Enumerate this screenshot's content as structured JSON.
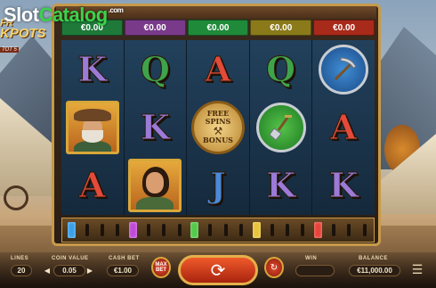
{
  "watermark": {
    "part1": "Slot",
    "part2": "Catalog",
    "part3": ".com"
  },
  "logo": {
    "line1": "FR",
    "line2": "KPOTS",
    "line3": "TOT 5"
  },
  "win_boxes": [
    {
      "value": "€0.00",
      "color": "#1f7a3a"
    },
    {
      "value": "€0.00",
      "color": "#7a3a8a"
    },
    {
      "value": "€0.00",
      "color": "#1f8a3a"
    },
    {
      "value": "€0.00",
      "color": "#8a7a1a"
    },
    {
      "value": "€0.00",
      "color": "#a82a1a"
    }
  ],
  "reels": [
    [
      {
        "type": "letter",
        "text": "K",
        "color": "#9b7ad8"
      },
      {
        "type": "miner",
        "name": "old-miner"
      },
      {
        "type": "letter",
        "text": "A",
        "color": "#e34a3a"
      }
    ],
    [
      {
        "type": "letter",
        "text": "Q",
        "color": "#3ea34a"
      },
      {
        "type": "letter",
        "text": "K",
        "color": "#9b7ad8"
      },
      {
        "type": "woman",
        "name": "woman-miner"
      }
    ],
    [
      {
        "type": "letter",
        "text": "A",
        "color": "#e34a3a"
      },
      {
        "type": "free_spins",
        "text1": "FREE SPINS",
        "text2": "BONUS"
      },
      {
        "type": "letter",
        "text": "J",
        "color": "#4a8ad8"
      }
    ],
    [
      {
        "type": "letter",
        "text": "Q",
        "color": "#3ea34a"
      },
      {
        "type": "shovel",
        "name": "shovel"
      },
      {
        "type": "letter",
        "text": "K",
        "color": "#9b7ad8"
      }
    ],
    [
      {
        "type": "pickaxe",
        "name": "pickaxe"
      },
      {
        "type": "letter",
        "text": "A",
        "color": "#e34a3a"
      },
      {
        "type": "letter",
        "text": "K",
        "color": "#9b7ad8"
      }
    ]
  ],
  "key_gem_colors": [
    "#3aa0e8",
    "#c24ad8",
    "#52c94a",
    "#e8c43a",
    "#e8433a"
  ],
  "bottom": {
    "lines_label": "LINES",
    "lines_value": "20",
    "coin_value_label": "COIN VALUE",
    "coin_value": "0.05",
    "cash_bet_label": "CASH BET",
    "cash_bet": "€1.00",
    "max_bet_label": "MAX BET",
    "win_label": "WIN",
    "win_value": "",
    "balance_label": "BALANCE",
    "balance_value": "€11,000.00"
  }
}
